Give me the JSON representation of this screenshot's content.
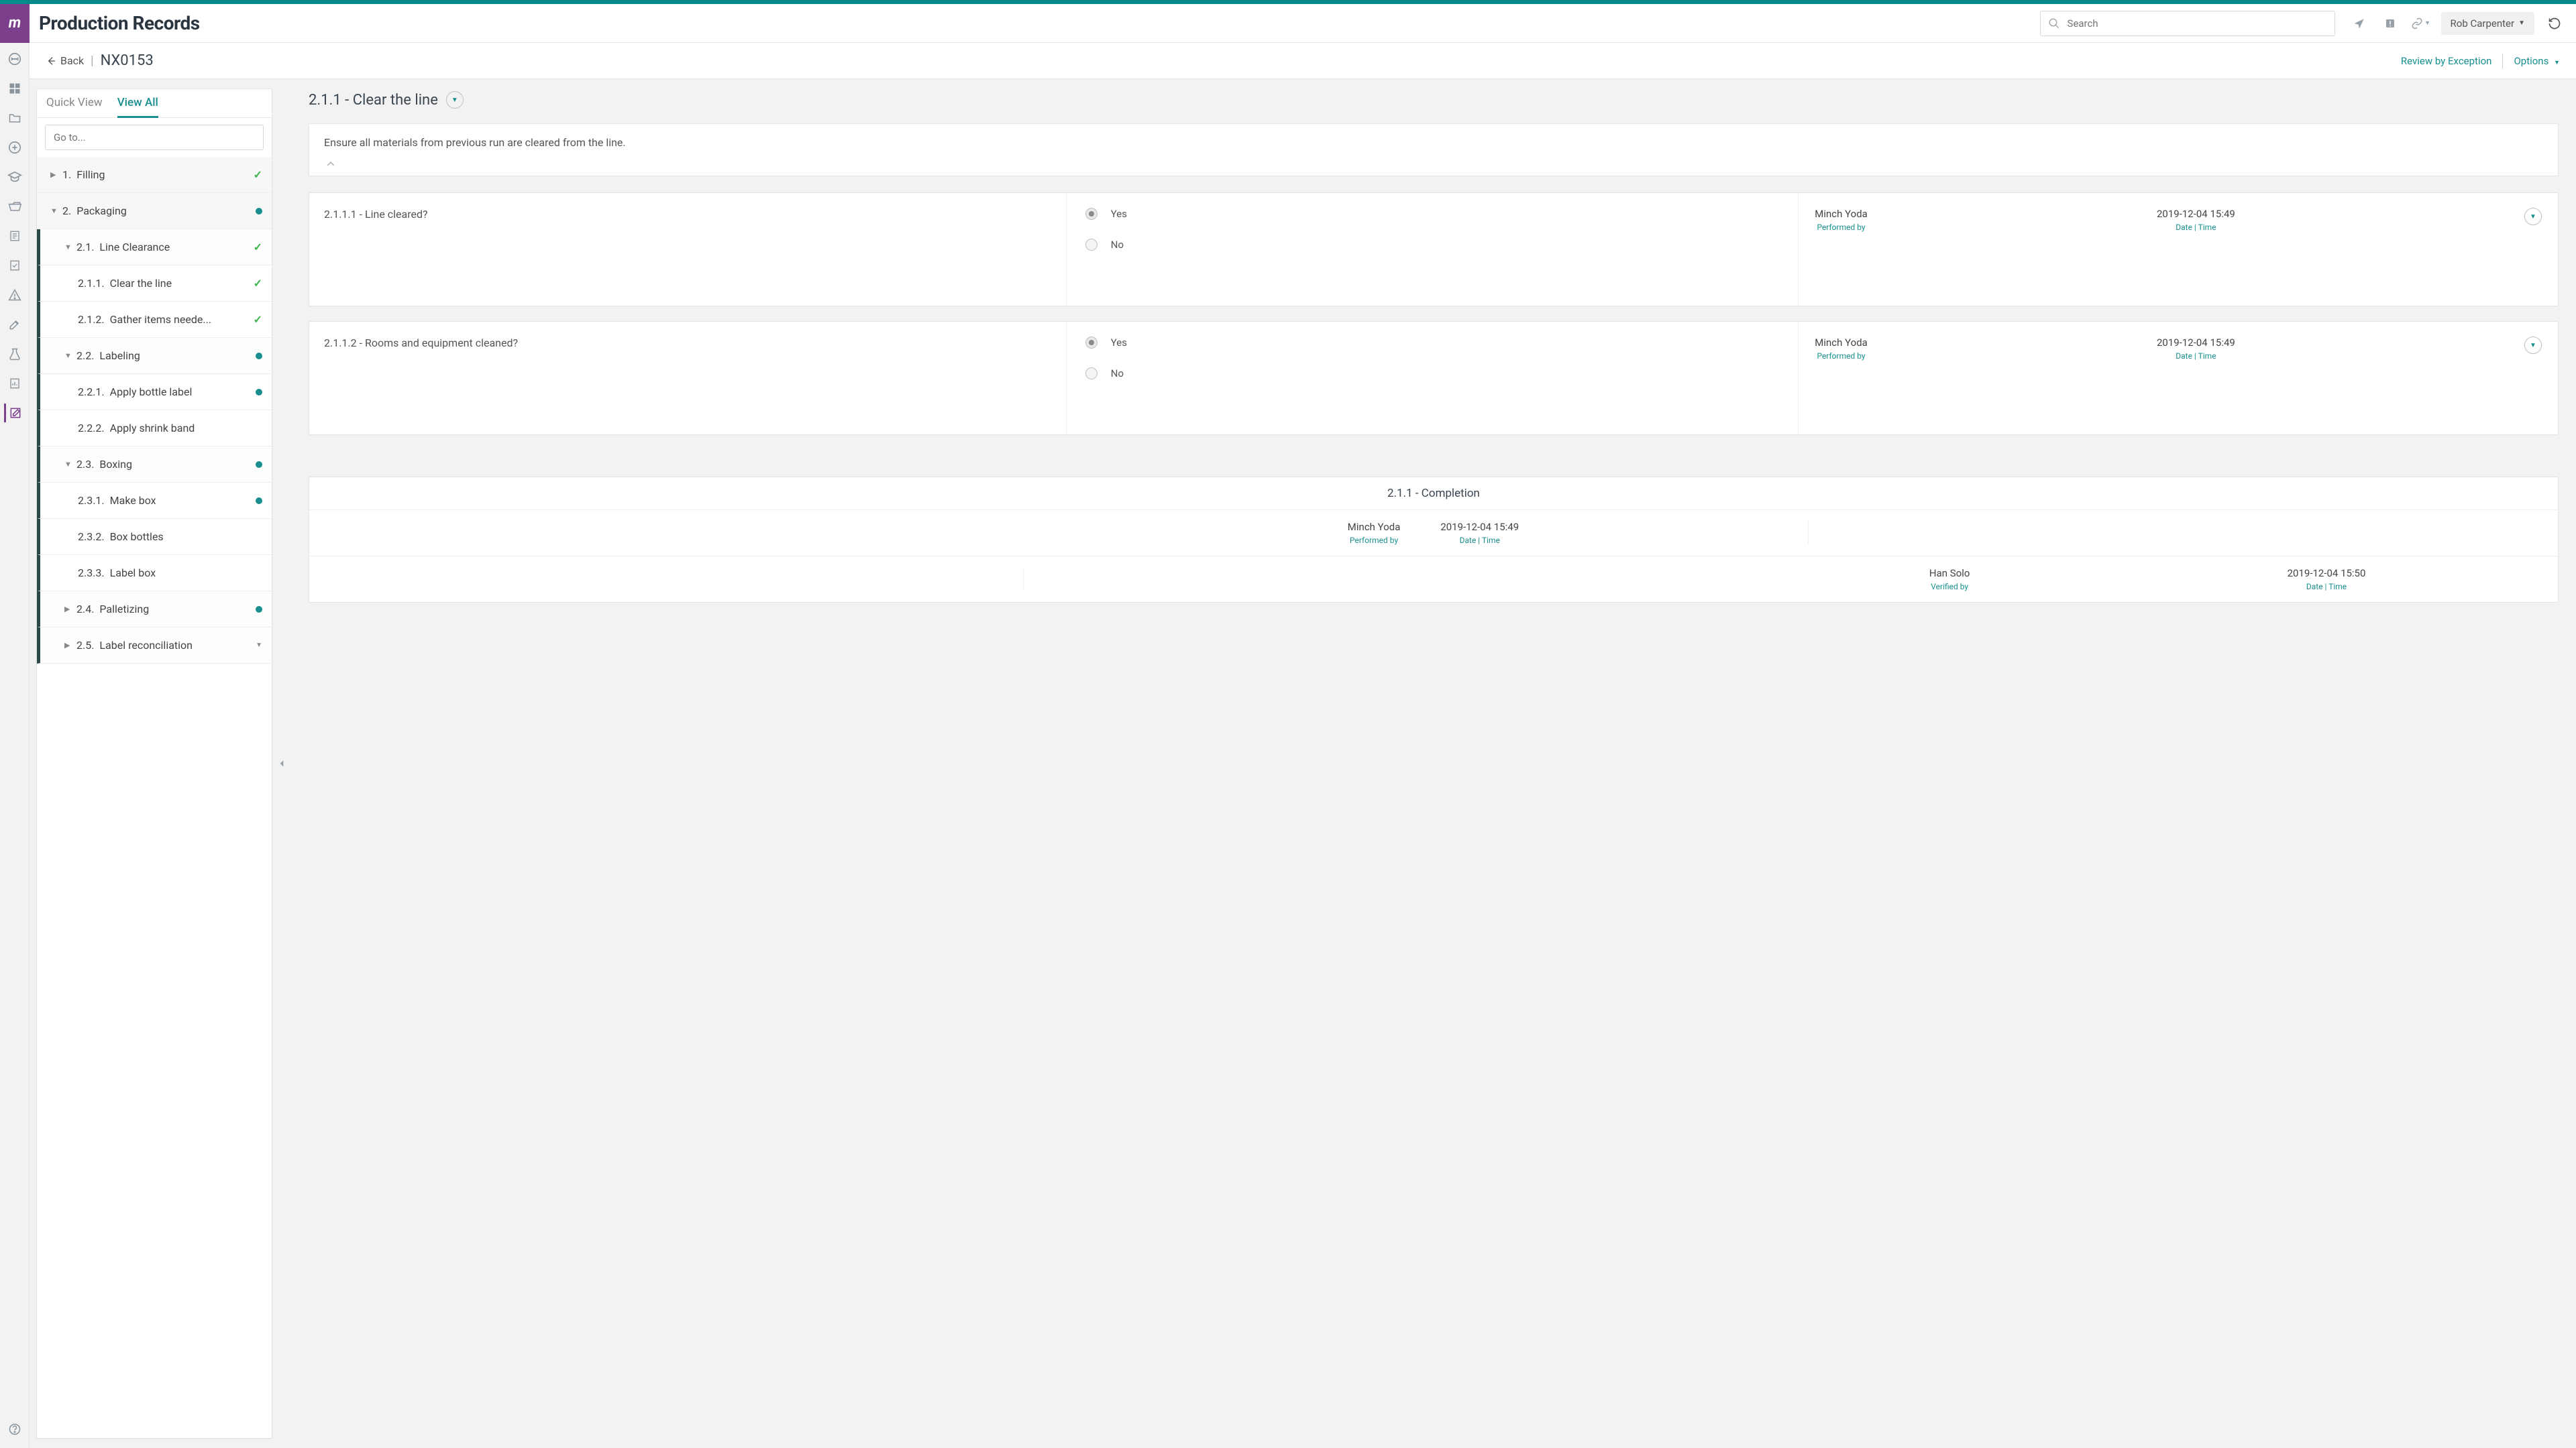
{
  "app": {
    "title": "Production Records"
  },
  "search": {
    "placeholder": "Search"
  },
  "user": {
    "name": "Rob Carpenter"
  },
  "breadcrumb": {
    "back": "Back",
    "id": "NX0153"
  },
  "header_links": {
    "review": "Review by Exception",
    "options": "Options"
  },
  "tree_tabs": {
    "quick": "Quick View",
    "all": "View All"
  },
  "goto": {
    "placeholder": "Go to..."
  },
  "tree": {
    "n1": {
      "num": "1.",
      "label": "Filling"
    },
    "n2": {
      "num": "2.",
      "label": "Packaging"
    },
    "n21": {
      "num": "2.1.",
      "label": "Line Clearance"
    },
    "n211": {
      "num": "2.1.1.",
      "label": "Clear the line"
    },
    "n212": {
      "num": "2.1.2.",
      "label": "Gather items neede..."
    },
    "n22": {
      "num": "2.2.",
      "label": "Labeling"
    },
    "n221": {
      "num": "2.2.1.",
      "label": "Apply bottle label"
    },
    "n222": {
      "num": "2.2.2.",
      "label": "Apply shrink band"
    },
    "n23": {
      "num": "2.3.",
      "label": "Boxing"
    },
    "n231": {
      "num": "2.3.1.",
      "label": "Make box"
    },
    "n232": {
      "num": "2.3.2.",
      "label": "Box bottles"
    },
    "n233": {
      "num": "2.3.3.",
      "label": "Label box"
    },
    "n24": {
      "num": "2.4.",
      "label": "Palletizing"
    },
    "n25": {
      "num": "2.5.",
      "label": "Label reconciliation"
    }
  },
  "detail": {
    "title": "2.1.1 - Clear the line",
    "instruction": "Ensure all materials from previous run are cleared from the line.",
    "q1": {
      "text": "2.1.1.1 - Line cleared?",
      "opt_yes": "Yes",
      "opt_no": "No",
      "performer": "Minch Yoda",
      "performer_lbl": "Performed by",
      "datetime": "2019-12-04 15:49",
      "datetime_lbl": "Date | Time"
    },
    "q2": {
      "text": "2.1.1.2 - Rooms and equipment cleaned?",
      "opt_yes": "Yes",
      "opt_no": "No",
      "performer": "Minch Yoda",
      "performer_lbl": "Performed by",
      "datetime": "2019-12-04 15:49",
      "datetime_lbl": "Date | Time"
    },
    "completion": {
      "title": "2.1.1 - Completion",
      "row1": {
        "who": "Minch Yoda",
        "who_lbl": "Performed by",
        "dt": "2019-12-04 15:49",
        "dt_lbl": "Date | Time"
      },
      "row2": {
        "who": "Han Solo",
        "who_lbl": "Verified by",
        "dt": "2019-12-04 15:50",
        "dt_lbl": "Date | Time"
      }
    }
  }
}
